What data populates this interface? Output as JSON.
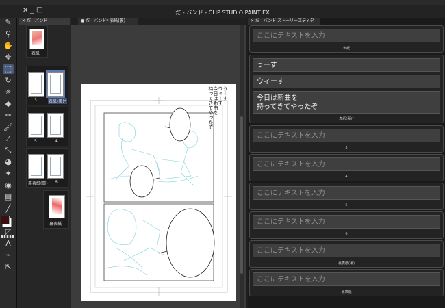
{
  "app": {
    "title": "だ - バンド - CLIP STUDIO PAINT EX",
    "title_icons": [
      "close-icon",
      "minimize-icon",
      "maximize-icon"
    ]
  },
  "tools": [
    "pen-icon",
    "zoom-icon",
    "hand-icon",
    "move-icon",
    "operation-icon",
    "rotate-icon",
    "auto-select-icon",
    "eraser-icon",
    "pencil-icon",
    "brush-icon",
    "airbrush-icon",
    "eyedropper-icon",
    "fill-icon",
    "decoration-icon",
    "blend-icon",
    "gradient-icon",
    "figure-icon",
    "frame-icon",
    "text-icon",
    "balloon-icon",
    "ruler-icon"
  ],
  "page_panel": {
    "tab_label": "だ - バンド",
    "pages": [
      {
        "label": "表紙"
      },
      {
        "label": "3"
      },
      {
        "label": "表紙(裏)*"
      },
      {
        "label": "5"
      },
      {
        "label": "4"
      },
      {
        "label": "裏表紙(裏)"
      },
      {
        "label": "6"
      },
      {
        "label": "裏表紙"
      }
    ]
  },
  "canvas": {
    "tab_label": "だ - バンド* 表紙(裏)",
    "vertical_text": [
      "うーす",
      "ウィーす",
      "今日は新曲を",
      "持ってきてやったぞ"
    ]
  },
  "story_editor": {
    "tab_label": "だ - バンド ストーリーエディター",
    "placeholder": "ここにテキストを入力",
    "cards": [
      {
        "label": "表紙",
        "fields": [
          {
            "text": "ここにテキストを入力",
            "placeholder": true
          }
        ]
      },
      {
        "label": "表紙(裏)*",
        "fields": [
          {
            "text": "うーす",
            "placeholder": false
          },
          {
            "text": "ウィーす",
            "placeholder": false
          },
          {
            "text": "今日は新曲を\n持ってきてやったぞ",
            "placeholder": false
          }
        ]
      },
      {
        "label": "3",
        "fields": [
          {
            "text": "ここにテキストを入力",
            "placeholder": true
          }
        ]
      },
      {
        "label": "4",
        "fields": [
          {
            "text": "ここにテキストを入力",
            "placeholder": true
          }
        ]
      },
      {
        "label": "5",
        "fields": [
          {
            "text": "ここにテキストを入力",
            "placeholder": true
          }
        ]
      },
      {
        "label": "6",
        "fields": [
          {
            "text": "ここにテキストを入力",
            "placeholder": true
          }
        ]
      },
      {
        "label": "裏表紙(裏)",
        "fields": [
          {
            "text": "ここにテキストを入力",
            "placeholder": true
          }
        ]
      },
      {
        "label": "裏表紙",
        "fields": [
          {
            "text": "ここにテキストを入力",
            "placeholder": true
          }
        ]
      }
    ]
  },
  "colors": {
    "main_color": "#3a1010",
    "sub_color": "#ffffff",
    "sketch": "#7fd0dc"
  }
}
